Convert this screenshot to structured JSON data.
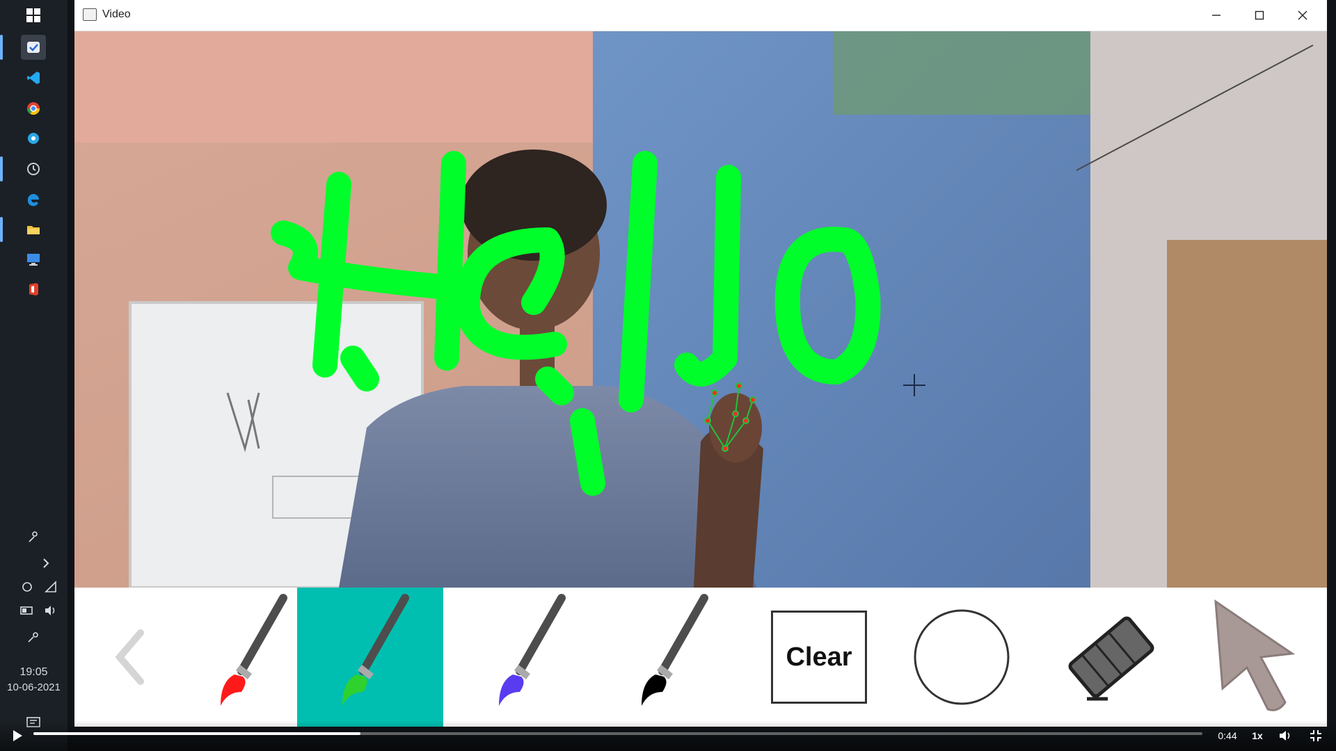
{
  "taskbar": {
    "icons": [
      "windows-start-icon",
      "pinned-app-icon",
      "vscode-icon",
      "chrome-icon",
      "edge-blue-icon",
      "clock-icon",
      "edge-icon",
      "file-explorer-icon",
      "remote-desktop-icon",
      "office-icon"
    ],
    "time": "19:05",
    "date": "10-06-2021"
  },
  "window": {
    "title": "Video",
    "controls": [
      "minimize",
      "maximize",
      "close"
    ]
  },
  "canvas": {
    "drawn_text": "Hello",
    "stroke_color": "#00ff2a"
  },
  "toolbar": {
    "tools": [
      {
        "name": "back-arrow",
        "type": "nav"
      },
      {
        "name": "red-brush",
        "color": "#ff1a1a",
        "selected": false
      },
      {
        "name": "green-brush",
        "color": "#2ed12e",
        "selected": true
      },
      {
        "name": "blue-brush",
        "color": "#5a3cf0",
        "selected": false
      },
      {
        "name": "black-brush",
        "color": "#000000",
        "selected": false
      },
      {
        "name": "clear",
        "label": "Clear"
      },
      {
        "name": "circle-shape"
      },
      {
        "name": "eraser"
      },
      {
        "name": "pointer"
      }
    ],
    "selected_color": "#00bfb0"
  },
  "player": {
    "time": "0:44",
    "speed": "1x",
    "progress": 0.28
  }
}
